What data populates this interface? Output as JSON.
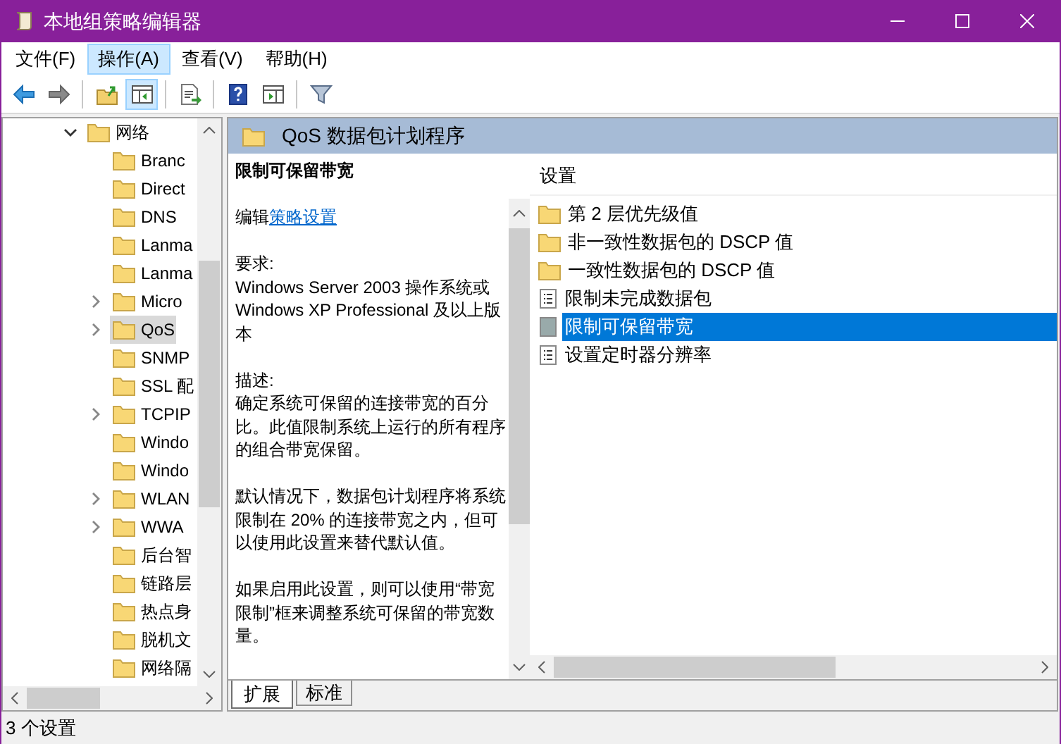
{
  "window": {
    "title": "本地组策略编辑器"
  },
  "menu": [
    {
      "label": "文件(F)",
      "selected": false
    },
    {
      "label": "操作(A)",
      "selected": true
    },
    {
      "label": "查看(V)",
      "selected": false
    },
    {
      "label": "帮助(H)",
      "selected": false
    }
  ],
  "toolbar": [
    {
      "kind": "back",
      "pressed": false
    },
    {
      "kind": "forward",
      "pressed": false
    },
    {
      "kind": "sep"
    },
    {
      "kind": "up",
      "pressed": false
    },
    {
      "kind": "tree",
      "pressed": true
    },
    {
      "kind": "sep"
    },
    {
      "kind": "export",
      "pressed": false
    },
    {
      "kind": "sep"
    },
    {
      "kind": "help",
      "pressed": false
    },
    {
      "kind": "pane",
      "pressed": false
    },
    {
      "kind": "sep"
    },
    {
      "kind": "filter",
      "pressed": false
    }
  ],
  "tree": {
    "items": [
      {
        "label": "网络",
        "expanded": true,
        "children": [
          {
            "label": "Branc",
            "expandable": false,
            "selected": false
          },
          {
            "label": "Direct",
            "expandable": false,
            "selected": false
          },
          {
            "label": "DNS",
            "expandable": false,
            "selected": false
          },
          {
            "label": "Lanma",
            "expandable": false,
            "selected": false
          },
          {
            "label": "Lanma",
            "expandable": false,
            "selected": false
          },
          {
            "label": "Micro",
            "expandable": true,
            "selected": false
          },
          {
            "label": "QoS",
            "expandable": true,
            "selected": true
          },
          {
            "label": "SNMP",
            "expandable": false,
            "selected": false
          },
          {
            "label": "SSL 配",
            "expandable": false,
            "selected": false
          },
          {
            "label": "TCPIP",
            "expandable": true,
            "selected": false
          },
          {
            "label": "Windo",
            "expandable": false,
            "selected": false
          },
          {
            "label": "Windo",
            "expandable": false,
            "selected": false
          },
          {
            "label": "WLAN",
            "expandable": true,
            "selected": false
          },
          {
            "label": "WWA",
            "expandable": true,
            "selected": false
          },
          {
            "label": "后台智",
            "expandable": false,
            "selected": false
          },
          {
            "label": "链路层",
            "expandable": false,
            "selected": false
          },
          {
            "label": "热点身",
            "expandable": false,
            "selected": false
          },
          {
            "label": "脱机文",
            "expandable": false,
            "selected": false
          },
          {
            "label": "网络隔",
            "expandable": false,
            "selected": false
          }
        ]
      }
    ]
  },
  "panel_header": "QoS 数据包计划程序",
  "description": {
    "title": "限制可保留带宽",
    "edit_prefix": "编辑",
    "edit_link": "策略设置",
    "paragraphs": [
      "要求:\nWindows Server 2003 操作系统或 Windows XP Professional 及以上版本",
      "描述:\n确定系统可保留的连接带宽的百分比。此值限制系统上运行的所有程序的组合带宽保留。",
      "默认情况下，数据包计划程序将系统限制在 20% 的连接带宽之内，但可以使用此设置来替代默认值。",
      "如果启用此设置，则可以使用“带宽限制”框来调整系统可保留的带宽数量。"
    ]
  },
  "list": {
    "column": "设置",
    "items": [
      {
        "label": "第 2 层优先级值",
        "kind": "folder",
        "selected": false
      },
      {
        "label": "非一致性数据包的 DSCP 值",
        "kind": "folder",
        "selected": false
      },
      {
        "label": "一致性数据包的 DSCP 值",
        "kind": "folder",
        "selected": false
      },
      {
        "label": "限制未完成数据包",
        "kind": "setting",
        "selected": false
      },
      {
        "label": "限制可保留带宽",
        "kind": "setting",
        "selected": true
      },
      {
        "label": "设置定时器分辨率",
        "kind": "setting",
        "selected": false
      }
    ]
  },
  "tabs": [
    {
      "label": "扩展",
      "selected": true
    },
    {
      "label": "标准",
      "selected": false
    }
  ],
  "status_bar": "3 个设置"
}
